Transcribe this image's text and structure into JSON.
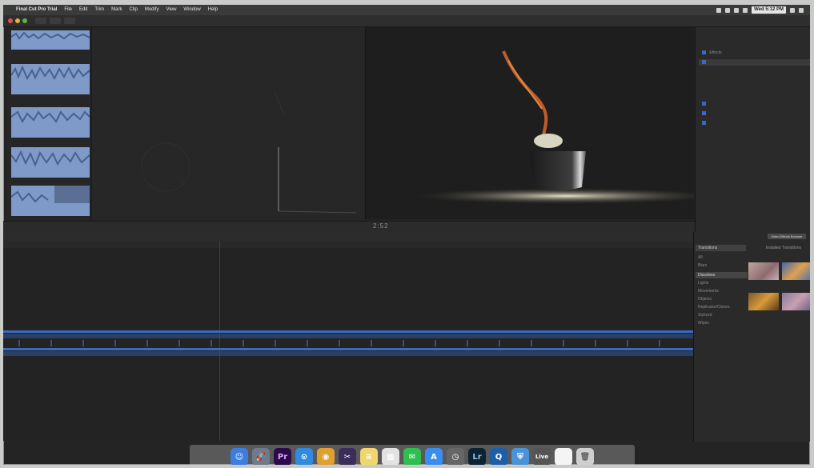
{
  "menubar": {
    "app_name": "Final Cut Pro Trial",
    "items": [
      "File",
      "Edit",
      "Trim",
      "Mark",
      "Clip",
      "Modify",
      "View",
      "Window",
      "Help"
    ],
    "clock": "Wed 5:12 PM"
  },
  "browser": {
    "clips": [
      "",
      "",
      "",
      "",
      ""
    ]
  },
  "viewer": {
    "timecode": "2:52"
  },
  "inspector": {
    "checks": [
      {
        "label": "Effects",
        "checked": true
      },
      {
        "label": "",
        "checked": true
      },
      {
        "label": "",
        "checked": true
      },
      {
        "label": "",
        "checked": true
      },
      {
        "label": "",
        "checked": true
      }
    ]
  },
  "transitions": {
    "tab": "Transitions",
    "button": "Video Effects Browser",
    "installed_label": "Installed Transitions",
    "categories": [
      "All",
      "Blurs",
      "Dissolves",
      "Lights",
      "Movements",
      "Objects",
      "Replicator/Clones",
      "Stylized",
      "Wipes"
    ],
    "selected_category": "Dissolves"
  },
  "dock": {
    "apps": [
      {
        "name": "finder-icon",
        "glyph": "☺",
        "color": "#3b7ee0"
      },
      {
        "name": "launchpad-icon",
        "glyph": "🚀",
        "color": "#6f7a8a"
      },
      {
        "name": "premiere-icon",
        "glyph": "Pr",
        "color": "#2a0a4a",
        "text_color": "#d9a6ff"
      },
      {
        "name": "safari-icon",
        "glyph": "⊙",
        "color": "#2f8ae0"
      },
      {
        "name": "chrome-icon",
        "glyph": "◉",
        "color": "#e0a02f"
      },
      {
        "name": "final-cut-icon",
        "glyph": "✂",
        "color": "#3c2c5c"
      },
      {
        "name": "notes-icon",
        "glyph": "≡",
        "color": "#f1d66b"
      },
      {
        "name": "photos-icon",
        "glyph": "▦",
        "color": "#e2e2e2"
      },
      {
        "name": "line-icon",
        "glyph": "✉",
        "color": "#2fbf4f"
      },
      {
        "name": "app-store-icon",
        "glyph": "A",
        "color": "#3a8ef0"
      },
      {
        "name": "time-machine-icon",
        "glyph": "◷",
        "color": "#666666"
      },
      {
        "name": "lightroom-icon",
        "glyph": "Lr",
        "color": "#0d2233",
        "text_color": "#8fc7ee"
      },
      {
        "name": "quicktime-icon",
        "glyph": "Q",
        "color": "#1c5fa8"
      },
      {
        "name": "shield-icon",
        "glyph": "⛨",
        "color": "#4a93d8"
      },
      {
        "name": "live-icon",
        "glyph": "Live",
        "color": "#555555"
      },
      {
        "name": "document-icon",
        "glyph": "",
        "color": "#f4f4f4"
      },
      {
        "name": "trash-icon",
        "glyph": "🗑",
        "color": "#cfcfcf",
        "text_color": "#666"
      }
    ]
  }
}
